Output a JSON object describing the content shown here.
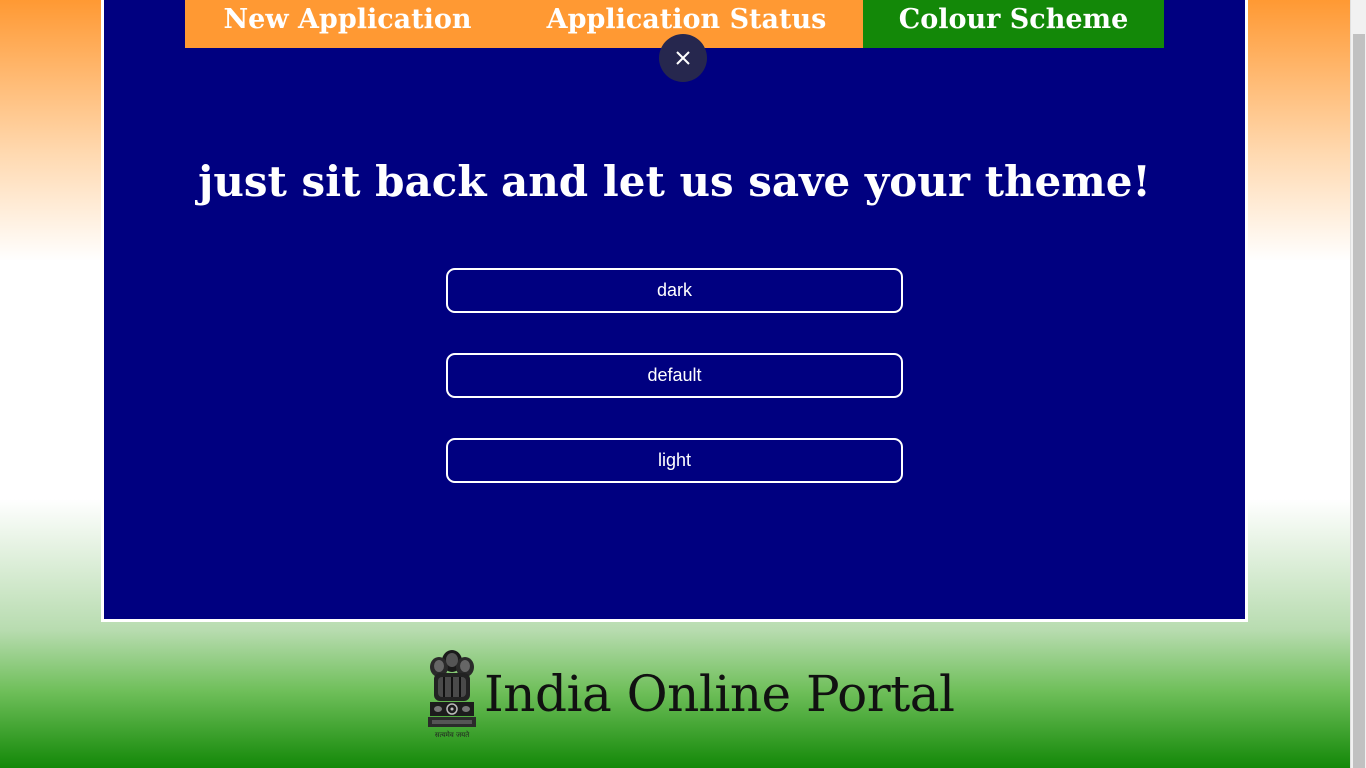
{
  "tabs": [
    {
      "label": "New Application"
    },
    {
      "label": "Application Status"
    },
    {
      "label": "Colour Scheme",
      "active": true
    }
  ],
  "modal": {
    "heading": "just sit back and let us save your theme!",
    "close_icon": "close-icon",
    "options": [
      {
        "label": "dark"
      },
      {
        "label": "default"
      },
      {
        "label": "light"
      }
    ]
  },
  "footer": {
    "emblem_icon": "national-emblem",
    "emblem_motto": "सत्यमेव जयते",
    "title": "India Online Portal"
  },
  "colors": {
    "saffron": "#ff9933",
    "green": "#138808",
    "navy": "#000080"
  }
}
